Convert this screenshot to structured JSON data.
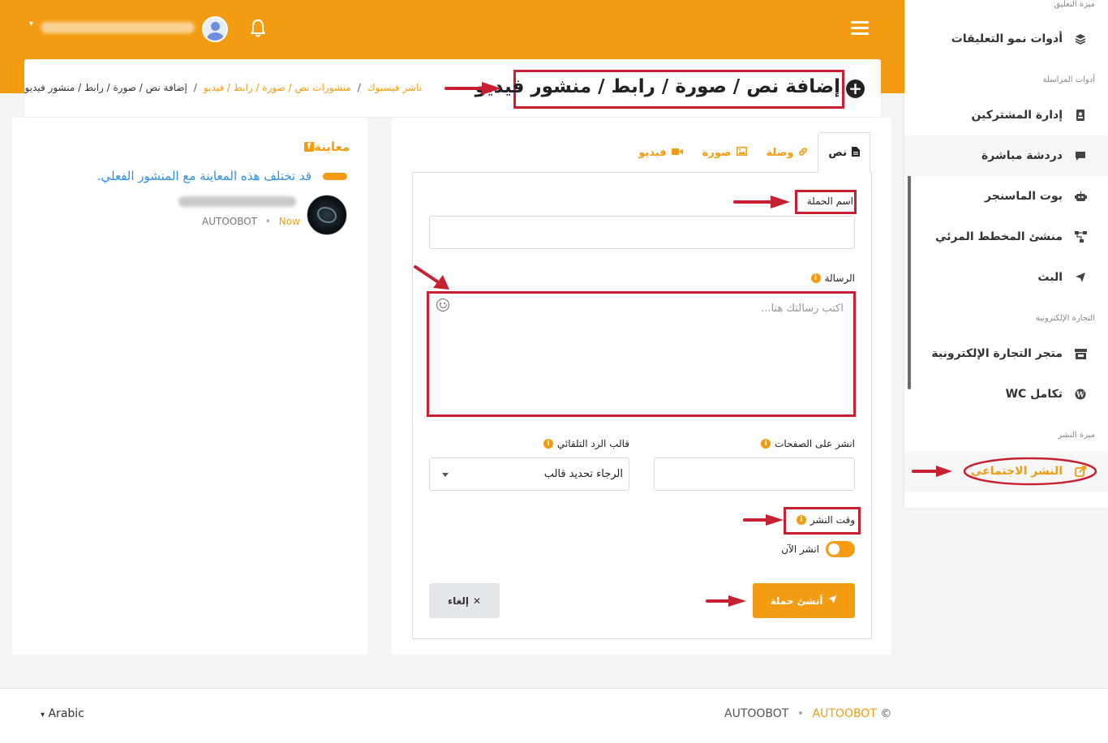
{
  "topbar": {
    "notifications_icon": "bell-icon",
    "menu_icon": "hamburger-icon"
  },
  "sidebar": {
    "sections": [
      {
        "title": "ميزة التعليق"
      },
      {
        "title": "أدوات المراسلة"
      },
      {
        "title": "التجارة الإلكترونية"
      },
      {
        "title": "ميزة النشر"
      }
    ],
    "items": [
      {
        "label": "أدوات نمو التعليقات",
        "icon": "layers-icon"
      },
      {
        "label": "إدارة المشتركين",
        "icon": "address-book-icon"
      },
      {
        "label": "دردشة مباشرة",
        "icon": "chat-icon"
      },
      {
        "label": "بوت الماسنجر",
        "icon": "robot-icon"
      },
      {
        "label": "منشئ المخطط المرئي",
        "icon": "flowchart-icon"
      },
      {
        "label": "البث",
        "icon": "send-icon"
      },
      {
        "label": "متجر التجارة الإلكترونية",
        "icon": "store-icon"
      },
      {
        "label": "تكامل WC",
        "icon": "wordpress-icon"
      },
      {
        "label": "النشر الاجتماعي",
        "icon": "share-icon"
      }
    ]
  },
  "header": {
    "title": "إضافة نص / صورة / رابط / منشور فيديو",
    "breadcrumb": [
      "ناشر فيسبوك",
      "منشورات نص / صورة / رابط / فيديو",
      "إضافة نص / صورة / رابط / منشور فيديو"
    ]
  },
  "preview": {
    "title": "معاينة",
    "note": "قد تختلف هذه المعاينة مع المنشور الفعلي.",
    "author": "AUTOOBOT",
    "time": "Now"
  },
  "form": {
    "tabs": [
      {
        "label": "نص",
        "icon": "file-icon"
      },
      {
        "label": "وصلة",
        "icon": "link-icon"
      },
      {
        "label": "صورة",
        "icon": "image-icon"
      },
      {
        "label": "فيديو",
        "icon": "video-icon"
      }
    ],
    "campaign_name_label": "اسم الحملة",
    "campaign_name_value": "",
    "message_label": "الرسالة",
    "message_placeholder": "اكتب رسالتك هنا...",
    "pages_label": "انشر على الصفحات",
    "template_label": "قالب الرد التلقائي",
    "template_value": "الرجاء تحديد قالب",
    "post_time_label": "وقت النشر",
    "post_now_label": "انشر الآن",
    "post_now_enabled": true,
    "submit_label": "أنشئ حملة",
    "cancel_label": "إلغاء"
  },
  "footer": {
    "language": "Arabic",
    "copyright_symbol": "©",
    "brand": "AUTOOBOT",
    "brand2": "AUTOOBOT"
  },
  "colors": {
    "accent": "#f39c12",
    "annotation": "#c62032",
    "link": "#2f8fe0"
  }
}
